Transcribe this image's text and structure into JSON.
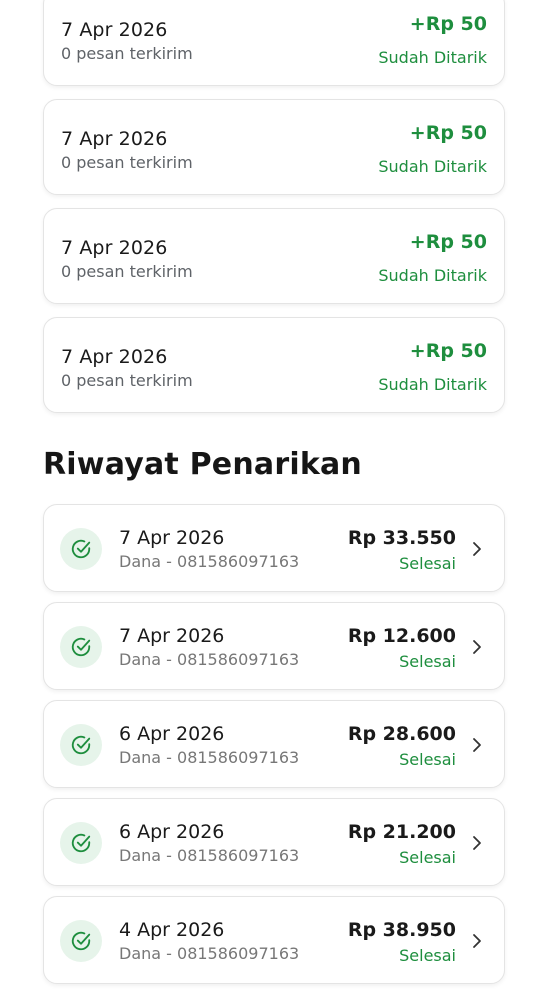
{
  "earnings": [
    {
      "date": "7 Apr 2026",
      "subtitle": "0 pesan terkirim",
      "amount": "+Rp 50",
      "status": "Sudah Ditarik"
    },
    {
      "date": "7 Apr 2026",
      "subtitle": "0 pesan terkirim",
      "amount": "+Rp 50",
      "status": "Sudah Ditarik"
    },
    {
      "date": "7 Apr 2026",
      "subtitle": "0 pesan terkirim",
      "amount": "+Rp 50",
      "status": "Sudah Ditarik"
    },
    {
      "date": "7 Apr 2026",
      "subtitle": "0 pesan terkirim",
      "amount": "+Rp 50",
      "status": "Sudah Ditarik"
    }
  ],
  "withdrawal_section": {
    "title": "Riwayat Penarikan"
  },
  "withdrawals": [
    {
      "date": "7 Apr 2026",
      "method": "Dana - 081586097163",
      "amount": "Rp 33.550",
      "status": "Selesai"
    },
    {
      "date": "7 Apr 2026",
      "method": "Dana - 081586097163",
      "amount": "Rp 12.600",
      "status": "Selesai"
    },
    {
      "date": "6 Apr 2026",
      "method": "Dana - 081586097163",
      "amount": "Rp 28.600",
      "status": "Selesai"
    },
    {
      "date": "6 Apr 2026",
      "method": "Dana - 081586097163",
      "amount": "Rp 21.200",
      "status": "Selesai"
    },
    {
      "date": "4 Apr 2026",
      "method": "Dana - 081586097163",
      "amount": "Rp 38.950",
      "status": "Selesai"
    }
  ],
  "icons": {
    "status": "check-circle-icon",
    "row_action": "chevron-right-icon"
  },
  "colors": {
    "accent_green": "#1e8e3e",
    "check_bg": "#e6f4ea"
  }
}
